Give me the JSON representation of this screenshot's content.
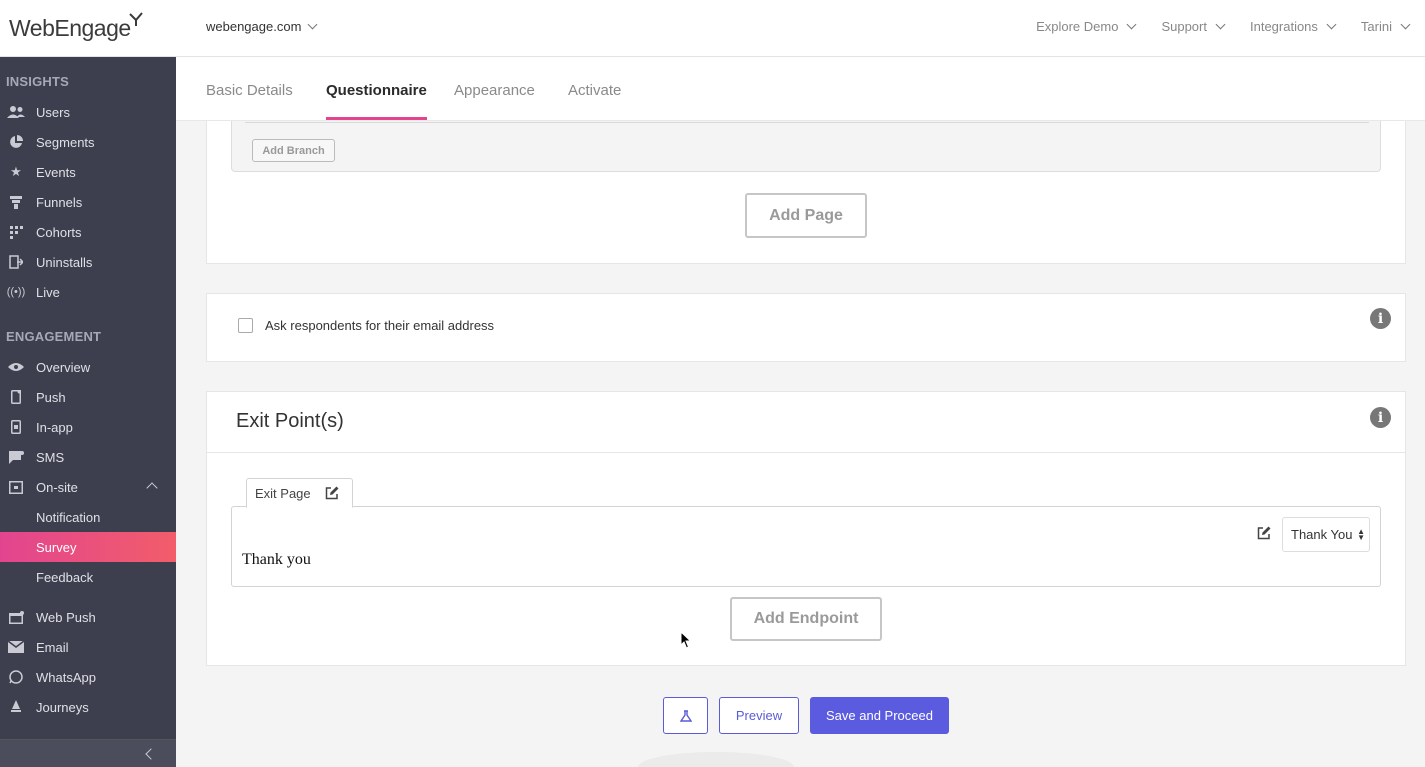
{
  "header": {
    "logo_text": "WebEngage",
    "account": "webengage.com",
    "nav": [
      "Explore Demo",
      "Support",
      "Integrations",
      "Tarini"
    ]
  },
  "sidebar": {
    "insights_title": "INSIGHTS",
    "insights": [
      {
        "label": "Users",
        "icon": "users-icon"
      },
      {
        "label": "Segments",
        "icon": "pie-icon"
      },
      {
        "label": "Events",
        "icon": "star-icon"
      },
      {
        "label": "Funnels",
        "icon": "funnel-icon"
      },
      {
        "label": "Cohorts",
        "icon": "grid-icon"
      },
      {
        "label": "Uninstalls",
        "icon": "uninstall-icon"
      },
      {
        "label": "Live",
        "icon": "live-icon"
      }
    ],
    "engagement_title": "ENGAGEMENT",
    "engagement": [
      {
        "label": "Overview",
        "icon": "eye-icon"
      },
      {
        "label": "Push",
        "icon": "mobile-icon"
      },
      {
        "label": "In-app",
        "icon": "inapp-icon"
      },
      {
        "label": "SMS",
        "icon": "sms-icon"
      },
      {
        "label": "On-site",
        "icon": "onsite-icon"
      }
    ],
    "onsite_sub": [
      "Notification",
      "Survey",
      "Feedback"
    ],
    "more": [
      {
        "label": "Web Push",
        "icon": "webpush-icon"
      },
      {
        "label": "Email",
        "icon": "email-icon"
      },
      {
        "label": "WhatsApp",
        "icon": "whatsapp-icon"
      },
      {
        "label": "Journeys",
        "icon": "journeys-icon"
      }
    ]
  },
  "tabs": [
    "Basic Details",
    "Questionnaire",
    "Appearance",
    "Activate"
  ],
  "active_tab": "Questionnaire",
  "questionnaire": {
    "add_branch": "Add Branch",
    "add_page": "Add Page"
  },
  "email_option": {
    "label": "Ask respondents for their email address",
    "checked": false
  },
  "exit_points": {
    "title": "Exit Point(s)",
    "tab_label": "Exit Page",
    "message": "Thank you",
    "select_value": "Thank You",
    "add_endpoint": "Add Endpoint"
  },
  "footer": {
    "preview": "Preview",
    "save": "Save and Proceed"
  },
  "colors": {
    "accent": "#e2458f",
    "primary": "#5b5be0",
    "sidebar_bg": "#3e3f4e"
  }
}
